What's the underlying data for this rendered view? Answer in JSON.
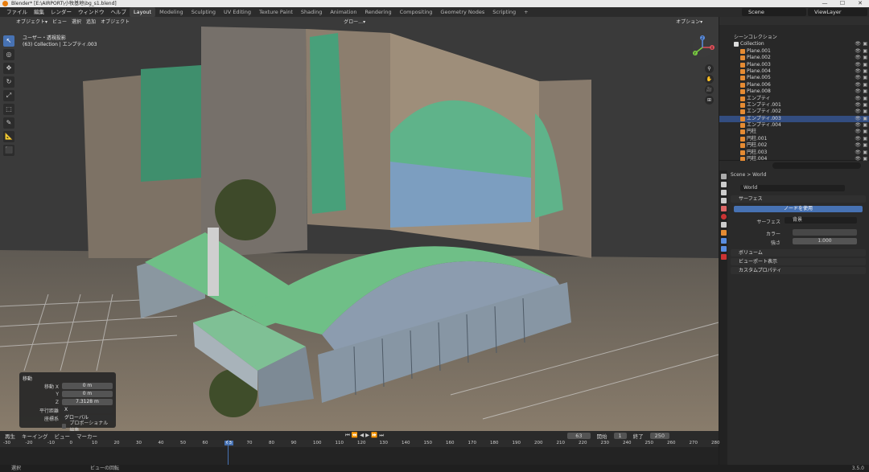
{
  "window": {
    "title": "Blender* [E:\\AIRPORT\\小牧基地\\bg_s1.blend]",
    "controls": [
      "—",
      "☐",
      "✕"
    ]
  },
  "menu": [
    "ファイル",
    "編集",
    "レンダー",
    "ウィンドウ",
    "ヘルプ"
  ],
  "workspaces": [
    "Layout",
    "Modeling",
    "Sculpting",
    "UV Editing",
    "Texture Paint",
    "Shading",
    "Animation",
    "Rendering",
    "Compositing",
    "Geometry Nodes",
    "Scripting",
    "+"
  ],
  "active_workspace": "Layout",
  "scene": "Scene",
  "view_layer": "ViewLayer",
  "viewport": {
    "header": [
      "オブジェクト▾",
      "ビュー",
      "選択",
      "追加",
      "オブジェクト",
      "グロー…▾",
      "オプション▾"
    ],
    "info_line1": "ユーザー・透視投影",
    "info_line2": "(63) Collection | エンプティ.003",
    "gizmo": {
      "x": "X",
      "y": "Y",
      "z": "Z"
    }
  },
  "tools": [
    "↖",
    "◎",
    "✥",
    "↻",
    "⤢",
    "⬚",
    "✎",
    "📐",
    "⬛"
  ],
  "nav_tools": [
    "⚲",
    "✋",
    "🎥",
    "⊞"
  ],
  "op_panel": {
    "title": "移動",
    "fields": [
      {
        "label": "移動 X",
        "value": "0 m"
      },
      {
        "label": "Y",
        "value": "0 m"
      },
      {
        "label": "Z",
        "value": "7.3128 m"
      },
      {
        "label": "平行距離",
        "value": "X"
      },
      {
        "label": "座標系",
        "value": "グローバル"
      }
    ],
    "checkbox": "プロポーショナル編集"
  },
  "outliner": {
    "header": "シーンコレクション",
    "items": [
      {
        "name": "Collection",
        "type": "collection"
      },
      {
        "name": "Plane.001",
        "type": "mesh"
      },
      {
        "name": "Plane.002",
        "type": "mesh"
      },
      {
        "name": "Plane.003",
        "type": "mesh"
      },
      {
        "name": "Plane.004",
        "type": "mesh"
      },
      {
        "name": "Plane.005",
        "type": "mesh"
      },
      {
        "name": "Plane.006",
        "type": "mesh"
      },
      {
        "name": "Plane.008",
        "type": "mesh"
      },
      {
        "name": "エンプティ",
        "type": "empty"
      },
      {
        "name": "エンプティ.001",
        "type": "empty"
      },
      {
        "name": "エンプティ.002",
        "type": "empty"
      },
      {
        "name": "エンプティ.003",
        "type": "empty",
        "selected": true
      },
      {
        "name": "エンプティ.004",
        "type": "empty"
      },
      {
        "name": "円柱",
        "type": "mesh"
      },
      {
        "name": "円柱.001",
        "type": "mesh"
      },
      {
        "name": "円柱.002",
        "type": "mesh"
      },
      {
        "name": "円柱.003",
        "type": "mesh"
      },
      {
        "name": "円柱.004",
        "type": "mesh"
      },
      {
        "name": "円柱.005",
        "type": "mesh"
      }
    ]
  },
  "properties": {
    "breadcrumb": [
      "Scene",
      "World"
    ],
    "world_name": "World",
    "surface_panel": "サーフェス",
    "use_nodes": "ノードを使用",
    "surface_label": "サーフェス",
    "surface_value": "背景",
    "color_label": "カラー",
    "strength_label": "強さ",
    "strength_value": "1.000",
    "volume_panel": "ボリューム",
    "viewport_panel": "ビューポート表示",
    "custom_panel": "カスタムプロパティ"
  },
  "timeline": {
    "menus": [
      "再生",
      "キーイング",
      "ビュー",
      "マーカー"
    ],
    "current_frame": "63",
    "start_label": "開始",
    "start": "1",
    "end_label": "終了",
    "end": "250",
    "ticks": [
      "-30",
      "-20",
      "-10",
      "0",
      "10",
      "20",
      "30",
      "40",
      "50",
      "60",
      "63",
      "70",
      "80",
      "90",
      "100",
      "110",
      "120",
      "130",
      "140",
      "150",
      "160",
      "170",
      "180",
      "190",
      "200",
      "210",
      "220",
      "230",
      "240",
      "250",
      "260",
      "270",
      "280"
    ]
  },
  "status": {
    "left": "選択",
    "middle": "ビューの回転",
    "right": "3.5.0"
  },
  "colors": {
    "accent": "#4772b3",
    "selected_row": "#334d80",
    "roof_green": "#6fbf87",
    "orange_icon": "#e58b33"
  }
}
